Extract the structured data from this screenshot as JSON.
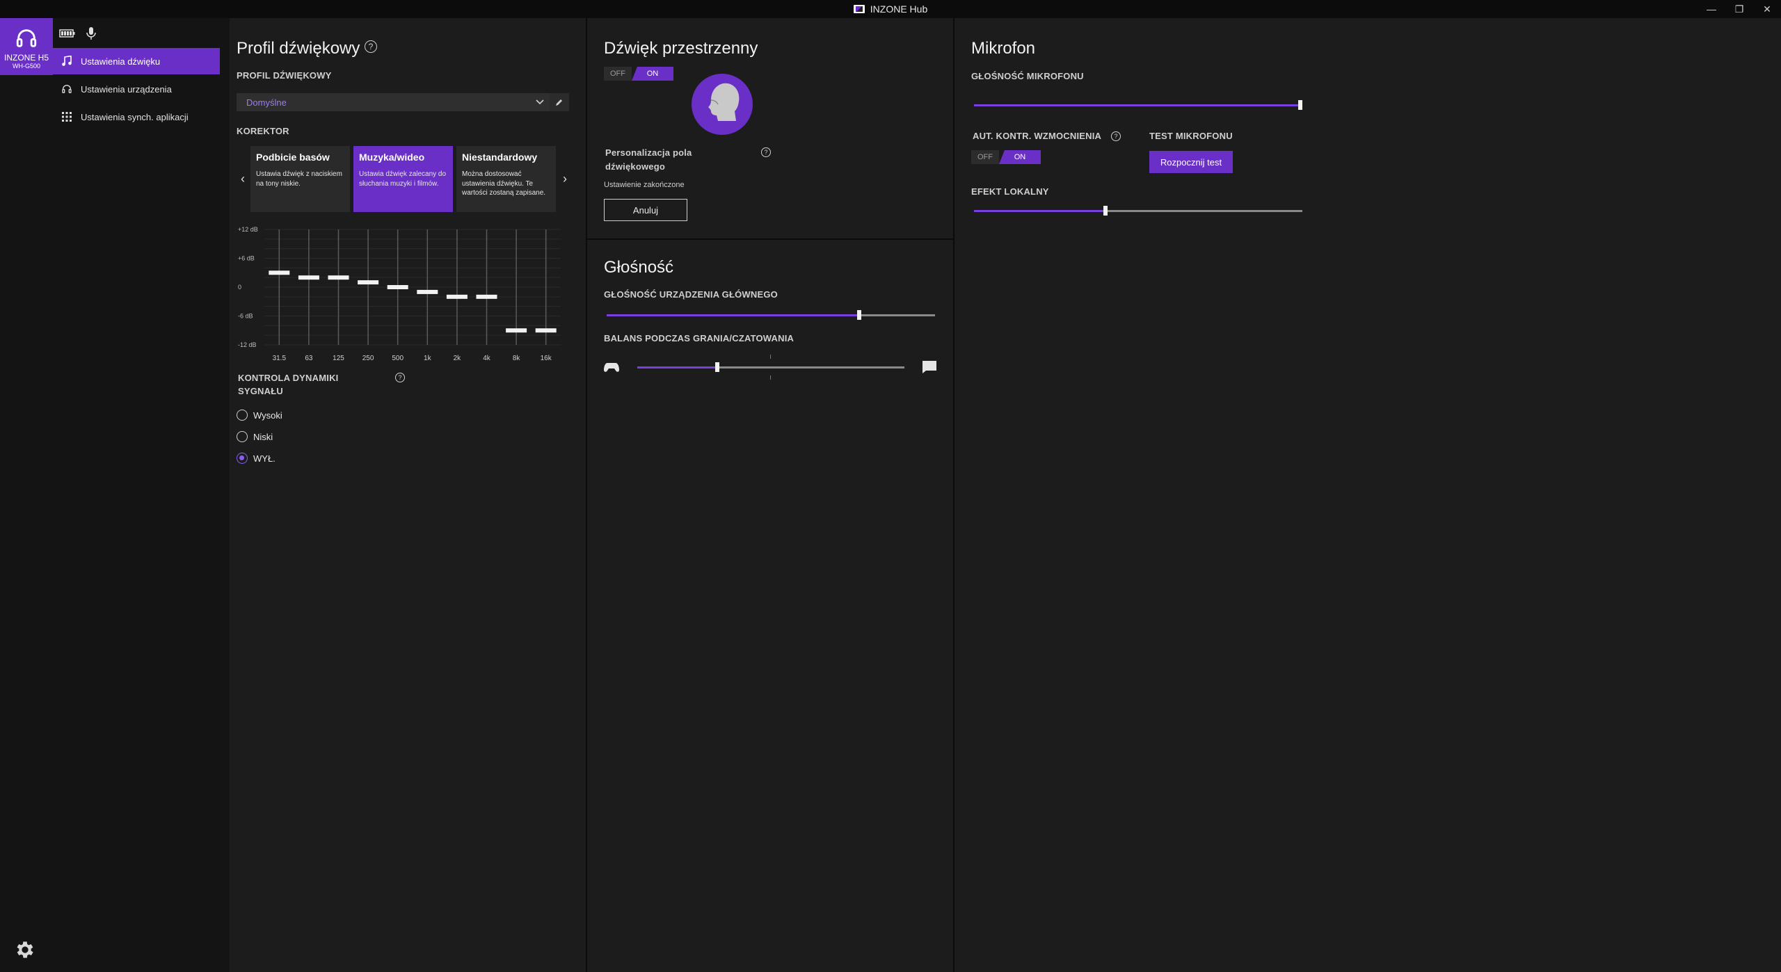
{
  "window": {
    "title": "INZONE Hub",
    "controls": {
      "minimize": "—",
      "restore": "❐",
      "close": "✕"
    }
  },
  "device": {
    "name": "INZONE H5",
    "model": "WH-G500"
  },
  "nav": {
    "items": [
      {
        "label": "Ustawienia dźwięku",
        "icon": "music-note-icon",
        "active": true
      },
      {
        "label": "Ustawienia urządzenia",
        "icon": "headphones-icon",
        "active": false
      },
      {
        "label": "Ustawienia synch. aplikacji",
        "icon": "grid-icon",
        "active": false
      }
    ]
  },
  "sound_profile": {
    "heading": "Profil dźwiękowy",
    "profile_label": "PROFIL DŹWIĘKOWY",
    "profile_value": "Domyślne",
    "equalizer_label": "KOREKTOR",
    "presets": [
      {
        "title": "Podbicie basów",
        "desc": "Ustawia dźwięk z naciskiem na tony niskie.",
        "selected": false
      },
      {
        "title": "Muzyka/wideo",
        "desc": "Ustawia dźwięk zalecany do słuchania muzyki i filmów.",
        "selected": true
      },
      {
        "title": "Niestandardowy",
        "desc": "Można dostosować ustawienia dźwięku. Te wartości zostaną zapisane.",
        "selected": false
      }
    ],
    "chart_data": {
      "type": "bar",
      "categories": [
        "31.5",
        "63",
        "125",
        "250",
        "500",
        "1k",
        "2k",
        "4k",
        "8k",
        "16k"
      ],
      "values": [
        3,
        2,
        2,
        1,
        0,
        -1,
        -2,
        -2,
        -9,
        -9
      ],
      "ylim": [
        -12,
        12
      ],
      "y_ticks": [
        "+12 dB",
        "+6 dB",
        "0",
        "-6 dB",
        "-12 dB"
      ],
      "y_tick_values": [
        12,
        6,
        0,
        -6,
        -12
      ]
    },
    "dynamics_label_line1": "KONTROLA DYNAMIKI",
    "dynamics_label_line2": "SYGNAŁU",
    "dynamics_options": [
      {
        "label": "Wysoki",
        "checked": false
      },
      {
        "label": "Niski",
        "checked": false
      },
      {
        "label": "WYŁ.",
        "checked": true
      }
    ]
  },
  "spatial": {
    "heading": "Dźwięk przestrzenny",
    "toggle_off": "OFF",
    "toggle_on": "ON",
    "toggle_state": "ON",
    "personalize_line1": "Personalizacja pola",
    "personalize_line2": "dźwiękowego",
    "status": "Ustawienie zakończone",
    "cancel_label": "Anuluj"
  },
  "volume": {
    "heading": "Głośność",
    "main_label": "GŁOŚNOŚĆ URZĄDZENIA GŁÓWNEGO",
    "main_value": 0.77,
    "balance_label": "BALANS PODCZAS GRANIA/CZATOWANIA",
    "balance_value": 0.3
  },
  "mic": {
    "heading": "Mikrofon",
    "volume_label": "GŁOŚNOŚĆ MIKROFONU",
    "volume_value": 1.0,
    "agc_label": "AUT. KONTR. WZMOCNIENIA",
    "agc_off": "OFF",
    "agc_on": "ON",
    "agc_state": "ON",
    "test_label": "TEST MIKROFONU",
    "test_button": "Rozpocznij test",
    "sidetone_label": "EFEKT LOKALNY",
    "sidetone_value": 0.4
  },
  "colors": {
    "accent": "#6a2fc7",
    "background": "#1c1c1c",
    "nav": "#141414"
  },
  "icons": {
    "settings": "gear-icon",
    "help": "question-icon"
  }
}
